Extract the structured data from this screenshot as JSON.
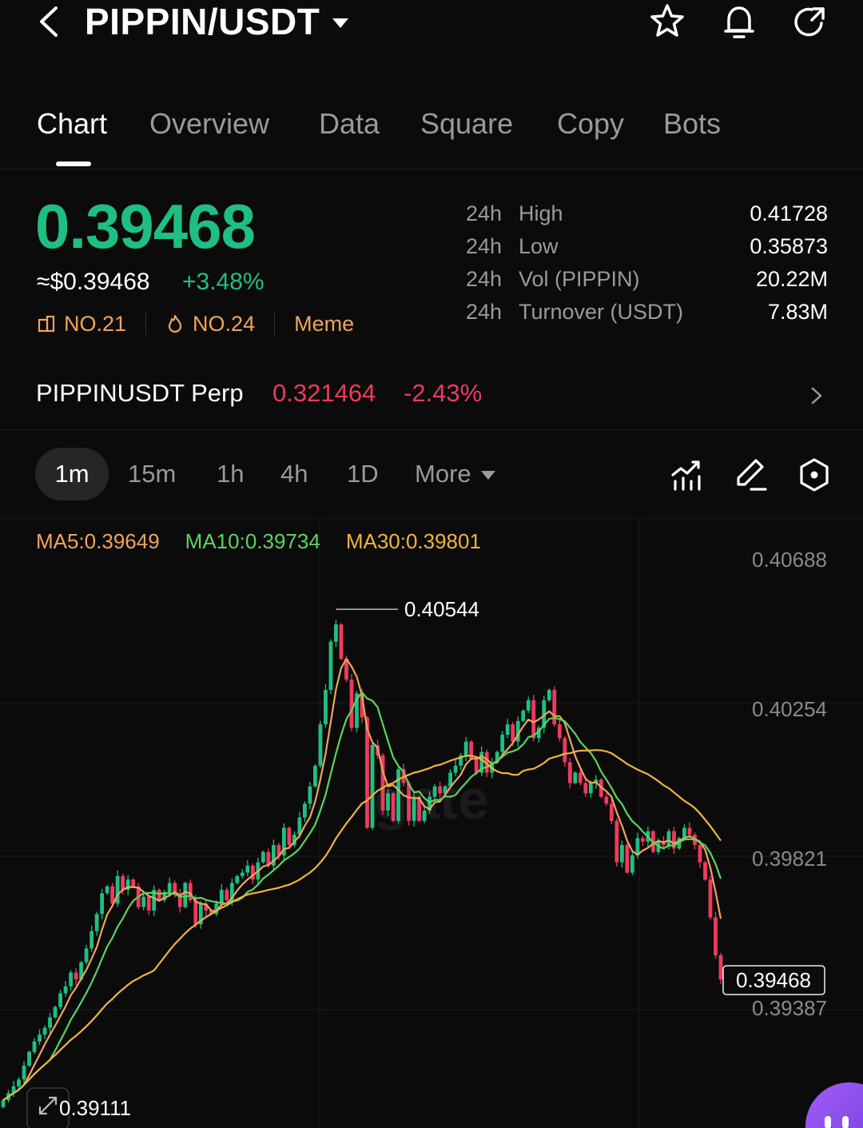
{
  "header": {
    "pair": "PIPPIN/USDT",
    "icons": [
      "chevron-left-icon",
      "caret-down-icon",
      "star-icon",
      "bell-icon",
      "share-icon"
    ]
  },
  "tabs": [
    {
      "label": "Chart",
      "active": true
    },
    {
      "label": "Overview",
      "active": false
    },
    {
      "label": "Data",
      "active": false
    },
    {
      "label": "Square",
      "active": false
    },
    {
      "label": "Copy",
      "active": false
    },
    {
      "label": "Bots",
      "active": false
    }
  ],
  "ticker": {
    "price": "0.39468",
    "usd_price": "≈$0.39468",
    "change_pct": "+3.48%",
    "rank_badge": "NO.21",
    "hot_badge": "NO.24",
    "category": "Meme",
    "colors": {
      "up": "#1fbf82",
      "down": "#f0395e",
      "badge": "#f0a45c"
    }
  },
  "stats": [
    {
      "period": "24h",
      "label": "High",
      "value": "0.41728"
    },
    {
      "period": "24h",
      "label": "Low",
      "value": "0.35873"
    },
    {
      "period": "24h",
      "label": "Vol (PIPPIN)",
      "value": "20.22M"
    },
    {
      "period": "24h",
      "label": "Turnover (USDT)",
      "value": "7.83M"
    }
  ],
  "perp": {
    "name": "PIPPINUSDT Perp",
    "price": "0.321464",
    "change_pct": "-2.43%"
  },
  "intervals": {
    "items": [
      {
        "label": "1m",
        "active": true
      },
      {
        "label": "15m",
        "active": false
      },
      {
        "label": "1h",
        "active": false
      },
      {
        "label": "4h",
        "active": false
      },
      {
        "label": "1D",
        "active": false
      }
    ],
    "more_label": "More",
    "tools": [
      "indicator-icon",
      "draw-pen-icon",
      "settings-hex-icon"
    ]
  },
  "chart_data": {
    "type": "candlestick",
    "interval": "1m",
    "ma": [
      {
        "label": "MA5:0.39649",
        "period": 5,
        "color": "#f0a45c"
      },
      {
        "label": "MA10:0.39734",
        "period": 10,
        "color": "#5dd35d"
      },
      {
        "label": "MA30:0.39801",
        "period": 30,
        "color": "#f0b43c"
      }
    ],
    "y_axis_ticks": [
      "0.40688",
      "0.40254",
      "0.39821",
      "0.39387"
    ],
    "y_ticks_values": [
      0.40688,
      0.40254,
      0.39821,
      0.39387
    ],
    "max_label": "0.40544",
    "max_value": 0.40544,
    "min_label": "0.39111",
    "min_value": 0.39111,
    "last_price_label": "0.39468",
    "last_price": 0.39468,
    "watermark": "gate",
    "closes": [
      0.3912,
      0.3914,
      0.3916,
      0.3918,
      0.3922,
      0.3926,
      0.3929,
      0.3931,
      0.3933,
      0.3936,
      0.3939,
      0.3943,
      0.3945,
      0.3949,
      0.3947,
      0.3952,
      0.3956,
      0.3961,
      0.3966,
      0.3972,
      0.3974,
      0.3969,
      0.3977,
      0.3973,
      0.3976,
      0.3974,
      0.3968,
      0.3971,
      0.3967,
      0.3973,
      0.397,
      0.3972,
      0.3975,
      0.3972,
      0.3968,
      0.3975,
      0.397,
      0.3963,
      0.3969,
      0.3967,
      0.3966,
      0.3969,
      0.3973,
      0.397,
      0.3975,
      0.3977,
      0.3978,
      0.398,
      0.3976,
      0.3981,
      0.3984,
      0.398,
      0.3986,
      0.3983,
      0.3991,
      0.3986,
      0.3989,
      0.3994,
      0.3998,
      0.4003,
      0.4009,
      0.4021,
      0.4031,
      0.4045,
      0.405,
      0.404,
      0.4034,
      0.402,
      0.403,
      0.4023,
      0.3991,
      0.4015,
      0.4012,
      0.3996,
      0.4001,
      0.3993,
      0.4008,
      0.4004,
      0.3993,
      0.4,
      0.3993,
      0.3996,
      0.4,
      0.4003,
      0.4001,
      0.4003,
      0.4007,
      0.4009,
      0.4012,
      0.4016,
      0.4011,
      0.4007,
      0.4013,
      0.4007,
      0.401,
      0.4013,
      0.4018,
      0.4021,
      0.4016,
      0.4022,
      0.4025,
      0.4028,
      0.4017,
      0.402,
      0.4028,
      0.4031,
      0.4021,
      0.4017,
      0.401,
      0.4004,
      0.4007,
      0.4004,
      0.4001,
      0.4004,
      0.4005,
      0.4,
      0.3998,
      0.3993,
      0.3981,
      0.3986,
      0.3978,
      0.3983,
      0.3988,
      0.3987,
      0.399,
      0.3984,
      0.3987,
      0.3986,
      0.399,
      0.3985,
      0.3988,
      0.3991,
      0.3989,
      0.3986,
      0.3981,
      0.3976,
      0.3965,
      0.3954,
      0.3947
    ]
  }
}
